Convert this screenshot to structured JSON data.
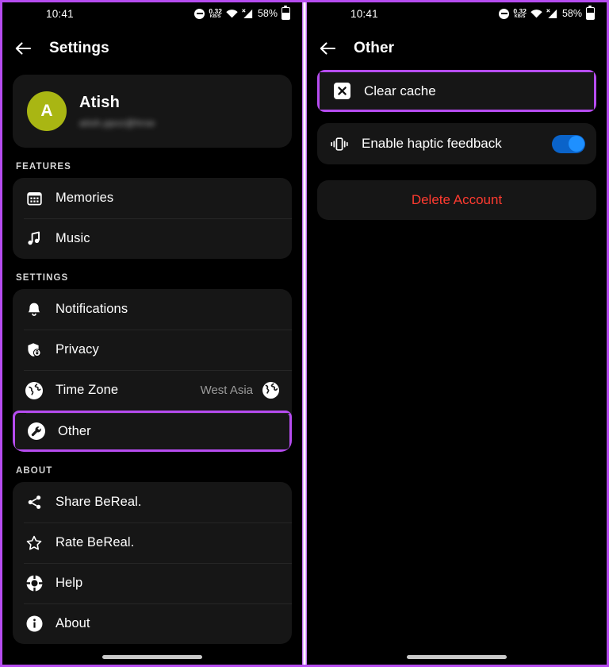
{
  "statusbar": {
    "time": "10:41",
    "net_speed_value": "0.32",
    "net_speed_unit": "KB/S",
    "battery_percent": "58%",
    "icons": [
      "dnd-icon",
      "network-speed",
      "wifi-icon",
      "signal-no-sim-icon",
      "battery-icon"
    ]
  },
  "left": {
    "header": {
      "title": "Settings",
      "back": "back-arrow"
    },
    "profile": {
      "avatar_letter": "A",
      "name": "Atish",
      "email": "atish.ppvz@hrse",
      "avatar_color": "#a9b613"
    },
    "sections": [
      {
        "label": "FEATURES",
        "items": [
          {
            "icon": "calendar-icon",
            "label": "Memories"
          },
          {
            "icon": "music-note-icon",
            "label": "Music"
          }
        ]
      },
      {
        "label": "SETTINGS",
        "items": [
          {
            "icon": "bell-icon",
            "label": "Notifications"
          },
          {
            "icon": "shield-lock-icon",
            "label": "Privacy"
          },
          {
            "icon": "globe-icon",
            "label": "Time Zone",
            "value": "West Asia",
            "trailing_icon": "earth-emoji-icon"
          },
          {
            "icon": "wrench-circle-icon",
            "label": "Other",
            "highlighted": true
          }
        ]
      },
      {
        "label": "ABOUT",
        "items": [
          {
            "icon": "share-icon",
            "label": "Share BeReal."
          },
          {
            "icon": "star-icon",
            "label": "Rate BeReal."
          },
          {
            "icon": "lifebuoy-icon",
            "label": "Help"
          },
          {
            "icon": "info-circle-icon",
            "label": "About"
          }
        ]
      }
    ]
  },
  "right": {
    "header": {
      "title": "Other",
      "back": "back-arrow"
    },
    "clear_cache": {
      "icon": "x-box-icon",
      "label": "Clear cache",
      "highlighted": true
    },
    "haptic": {
      "icon": "vibration-icon",
      "label": "Enable haptic feedback",
      "toggle_on": true,
      "toggle_color": "#1e90ff"
    },
    "delete_account": {
      "label": "Delete Account",
      "color": "#ff3b30"
    }
  },
  "highlight_color": "#b64cf0"
}
